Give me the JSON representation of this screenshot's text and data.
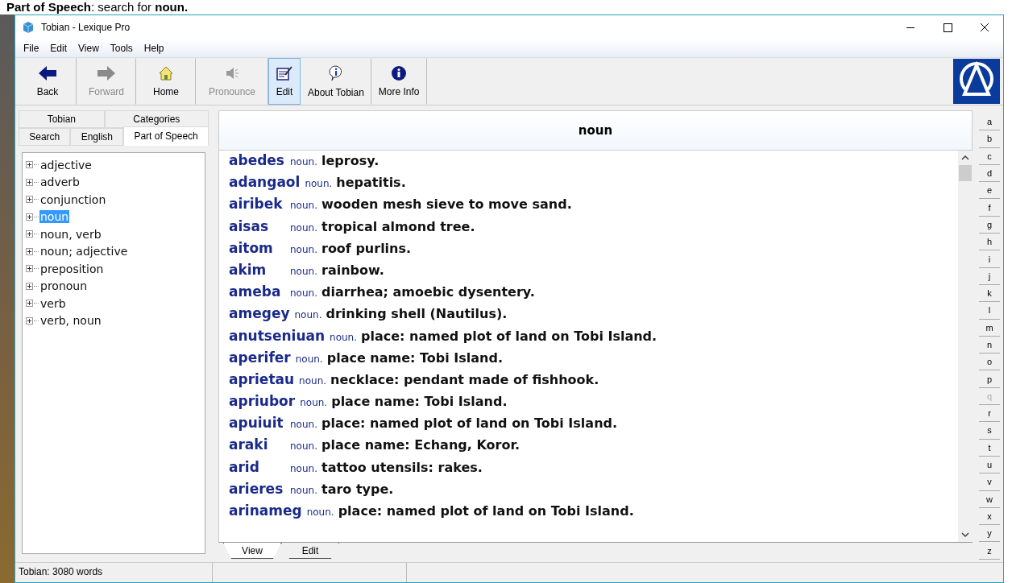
{
  "caption": "**Part of Speech**: search for **noun.**",
  "window": {
    "title": "Tobian - Lexique Pro"
  },
  "menu": [
    "File",
    "Edit",
    "View",
    "Tools",
    "Help"
  ],
  "toolbar": [
    {
      "kind": "back",
      "label": "Back",
      "disabled": false,
      "selected": false
    },
    {
      "kind": "forward",
      "label": "Forward",
      "disabled": true,
      "selected": false
    },
    {
      "kind": "home",
      "label": "Home",
      "disabled": false,
      "selected": false
    },
    {
      "kind": "pronounce",
      "label": "Pronounce",
      "disabled": true,
      "selected": false
    },
    {
      "kind": "edit",
      "label": "Edit",
      "disabled": false,
      "selected": true
    },
    {
      "kind": "about",
      "label": "About Tobian",
      "disabled": false,
      "selected": false
    },
    {
      "kind": "info",
      "label": "More Info",
      "disabled": false,
      "selected": false
    }
  ],
  "tabs_top": [
    {
      "label": "Tobian",
      "selected": false
    },
    {
      "label": "Categories",
      "selected": false
    }
  ],
  "tabs_bottom": [
    {
      "label": "Search",
      "selected": false
    },
    {
      "label": "English",
      "selected": false
    },
    {
      "label": "Part of Speech",
      "selected": true
    }
  ],
  "tree": [
    {
      "label": "adjective",
      "selected": false,
      "expanded": false
    },
    {
      "label": "adverb",
      "selected": false,
      "expanded": false
    },
    {
      "label": "conjunction",
      "selected": false,
      "expanded": false
    },
    {
      "label": "noun",
      "selected": true,
      "expanded": false
    },
    {
      "label": "noun, verb",
      "selected": false,
      "expanded": false
    },
    {
      "label": "noun; adjective",
      "selected": false,
      "expanded": false
    },
    {
      "label": "preposition",
      "selected": false,
      "expanded": false
    },
    {
      "label": "pronoun",
      "selected": false,
      "expanded": false
    },
    {
      "label": "verb",
      "selected": false,
      "expanded": false
    },
    {
      "label": "verb, noun",
      "selected": false,
      "expanded": false
    }
  ],
  "header": "noun",
  "entries": [
    {
      "word": "abedes",
      "pos": "noun.",
      "def": "leprosy."
    },
    {
      "word": "adangaol",
      "pos": "noun.",
      "def": "hepatitis."
    },
    {
      "word": "airibek",
      "pos": "noun.",
      "def": "wooden mesh sieve to move sand."
    },
    {
      "word": "aisas",
      "pos": "noun.",
      "def": "tropical almond tree."
    },
    {
      "word": "aitom",
      "pos": "noun.",
      "def": "roof purlins."
    },
    {
      "word": "akim",
      "pos": "noun.",
      "def": "rainbow."
    },
    {
      "word": "ameba",
      "pos": "noun.",
      "def": "diarrhea; amoebic dysentery."
    },
    {
      "word": "amegey",
      "pos": "noun.",
      "def": "drinking shell (Nautilus)."
    },
    {
      "word": "anutseniuan",
      "pos": "noun.",
      "def": "place: named plot of land on Tobi Island."
    },
    {
      "word": "aperifer",
      "pos": "noun.",
      "def": "place name: Tobi Island."
    },
    {
      "word": "aprietau",
      "pos": "noun.",
      "def": "necklace: pendant made of fishhook."
    },
    {
      "word": "apriubor",
      "pos": "noun.",
      "def": "place name: Tobi Island."
    },
    {
      "word": "apuiuit",
      "pos": "noun.",
      "def": "place: named plot of land on Tobi Island."
    },
    {
      "word": "araki",
      "pos": "noun.",
      "def": "place name: Echang, Koror."
    },
    {
      "word": "arid",
      "pos": "noun.",
      "def": "tattoo utensils: rakes."
    },
    {
      "word": "arieres",
      "pos": "noun.",
      "def": "taro type."
    },
    {
      "word": "arinameg",
      "pos": "noun.",
      "def": "place: named plot of land on Tobi Island."
    }
  ],
  "view_tabs": [
    {
      "label": "View",
      "selected": true
    },
    {
      "label": "Edit",
      "selected": false
    }
  ],
  "letters": [
    {
      "label": "a",
      "disabled": false
    },
    {
      "label": "b",
      "disabled": false
    },
    {
      "label": "c",
      "disabled": false
    },
    {
      "label": "d",
      "disabled": false
    },
    {
      "label": "e",
      "disabled": false
    },
    {
      "label": "f",
      "disabled": false
    },
    {
      "label": "g",
      "disabled": false
    },
    {
      "label": "h",
      "disabled": false
    },
    {
      "label": "i",
      "disabled": false
    },
    {
      "label": "j",
      "disabled": false
    },
    {
      "label": "k",
      "disabled": false
    },
    {
      "label": "l",
      "disabled": false
    },
    {
      "label": "m",
      "disabled": false
    },
    {
      "label": "n",
      "disabled": false
    },
    {
      "label": "o",
      "disabled": false
    },
    {
      "label": "p",
      "disabled": false
    },
    {
      "label": "q",
      "disabled": true
    },
    {
      "label": "r",
      "disabled": false
    },
    {
      "label": "s",
      "disabled": false
    },
    {
      "label": "t",
      "disabled": false
    },
    {
      "label": "u",
      "disabled": false
    },
    {
      "label": "v",
      "disabled": false
    },
    {
      "label": "w",
      "disabled": false
    },
    {
      "label": "x",
      "disabled": false
    },
    {
      "label": "y",
      "disabled": false
    },
    {
      "label": "z",
      "disabled": false
    }
  ],
  "status_bar": "Tobian: 3080 words"
}
